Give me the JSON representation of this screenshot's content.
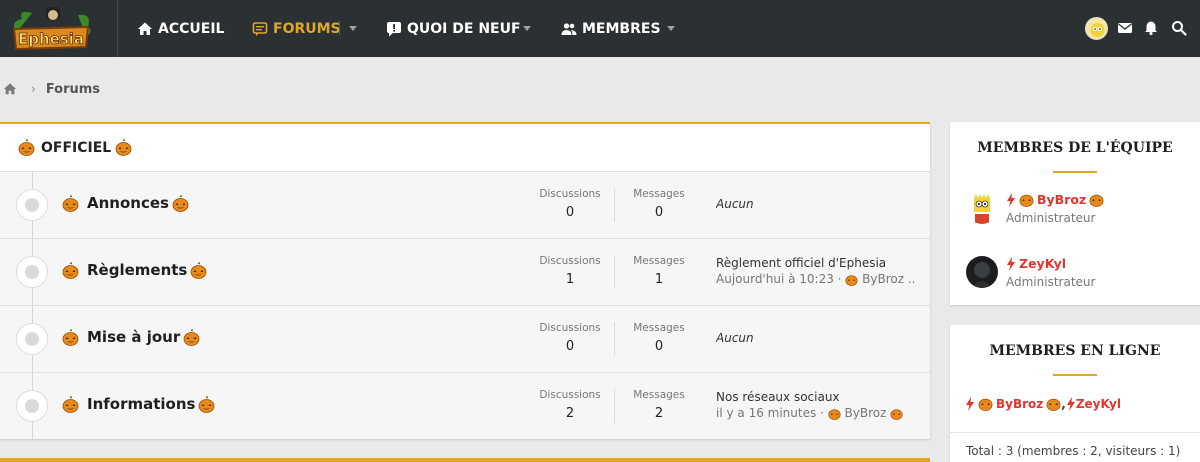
{
  "nav": {
    "logo_text": "Ephesia",
    "items": [
      {
        "label": "ACCUEIL",
        "icon": "home-icon"
      },
      {
        "label": "FORUMS",
        "icon": "forum-icon",
        "active": true
      },
      {
        "label": "QUOI DE NEUF",
        "icon": "whats-new-icon"
      },
      {
        "label": "MEMBRES",
        "icon": "members-icon"
      }
    ],
    "user_icons": [
      "avatar",
      "mail-icon",
      "bell-icon",
      "search-icon"
    ]
  },
  "breadcrumb": {
    "current": "Forums"
  },
  "category": {
    "title": "OFFICIEL",
    "nodes": [
      {
        "title": "Annonces",
        "discussions_label": "Discussions",
        "discussions": "0",
        "messages_label": "Messages",
        "messages": "0",
        "last_none": "Aucun"
      },
      {
        "title": "Règlements",
        "discussions_label": "Discussions",
        "discussions": "1",
        "messages_label": "Messages",
        "messages": "1",
        "last_title": "Règlement officiel d'Ephesia",
        "last_meta": "Aujourd'hui à 10:23 · ",
        "last_user": "ByBroz ..."
      },
      {
        "title": "Mise à jour",
        "discussions_label": "Discussions",
        "discussions": "0",
        "messages_label": "Messages",
        "messages": "0",
        "last_none": "Aucun"
      },
      {
        "title": "Informations",
        "discussions_label": "Discussions",
        "discussions": "2",
        "messages_label": "Messages",
        "messages": "2",
        "last_title": "Nos réseaux sociaux",
        "last_meta": "il y a 16 minutes · ",
        "last_user": "ByBroz"
      }
    ]
  },
  "sidebar": {
    "staff": {
      "title": "MEMBRES DE L'ÉQUIPE",
      "members": [
        {
          "name": "ByBroz",
          "role": "Administrateur"
        },
        {
          "name": "ZeyKyl",
          "role": "Administrateur"
        }
      ]
    },
    "online": {
      "title": "MEMBRES EN LIGNE",
      "users": [
        "ByBroz",
        "ZeyKyl"
      ],
      "separator": ",",
      "total": "Total : 3 (membres : 2, visiteurs : 1)"
    }
  },
  "colors": {
    "accent": "#e0a62a",
    "nav_bg": "#2b3133",
    "staff_red": "#e3342f"
  }
}
